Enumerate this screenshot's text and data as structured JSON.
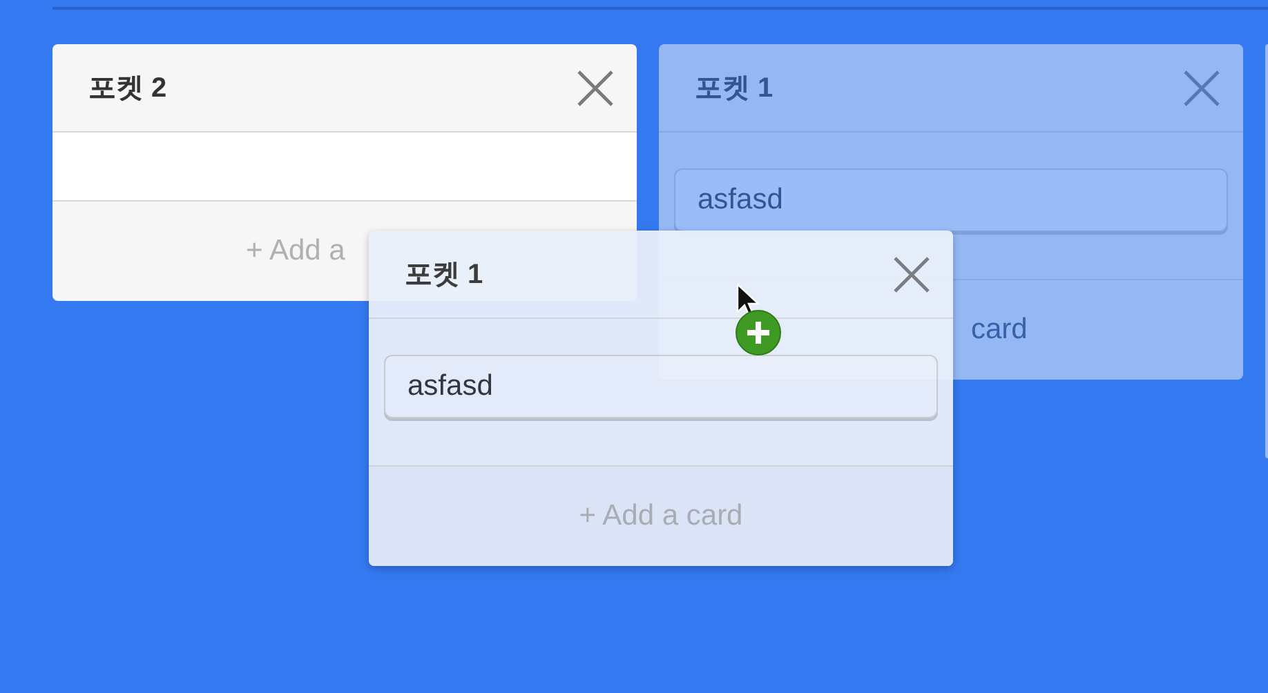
{
  "lists": [
    {
      "title": "포켓 2",
      "kind": "normal",
      "add_label": "+ Add a"
    },
    {
      "title": "포켓 1",
      "kind": "placeholder",
      "cards": [
        "asfasd"
      ],
      "add_label": "card"
    },
    {
      "kind": "edge"
    }
  ],
  "dragging": {
    "title": "포켓 1",
    "cards": [
      "asfasd"
    ],
    "add_label": "+ Add a card"
  }
}
